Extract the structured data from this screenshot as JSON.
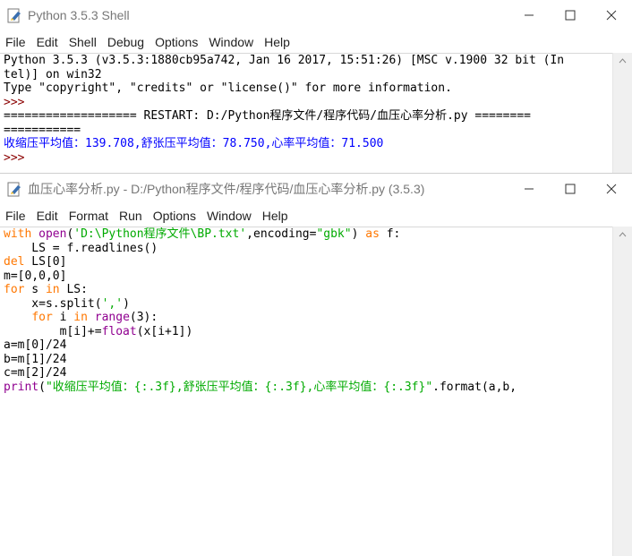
{
  "shell": {
    "title": "Python 3.5.3 Shell",
    "menu": [
      "File",
      "Edit",
      "Shell",
      "Debug",
      "Options",
      "Window",
      "Help"
    ],
    "lines": [
      "Python 3.5.3 (v3.5.3:1880cb95a742, Jan 16 2017, 15:51:26) [MSC v.1900 32 bit (In",
      "tel)] on win32",
      "Type \"copyright\", \"credits\" or \"license()\" for more information.",
      ">>>",
      "=================== RESTART: D:/Python程序文件/程序代码/血压心率分析.py ========",
      "===========",
      "收缩压平均值：139.708,舒张压平均值：78.750,心率平均值：71.500",
      ">>>"
    ]
  },
  "editor": {
    "title": "血压心率分析.py - D:/Python程序文件/程序代码/血压心率分析.py (3.5.3)",
    "menu": [
      "File",
      "Edit",
      "Format",
      "Run",
      "Options",
      "Window",
      "Help"
    ],
    "code": {
      "l1_kw": "with",
      "l1_b": "open",
      "l1_p1": "(",
      "l1_s1": "'D:\\Python程序文件\\BP.txt'",
      "l1_p2": ",encoding=",
      "l1_s2": "\"gbk\"",
      "l1_p3": ") ",
      "l1_kw2": "as",
      "l1_p4": " f:",
      "l2": "    LS = f.readlines()",
      "l3_kw": "del",
      "l3_p": " LS[0]",
      "l4": "m=[0,0,0]",
      "l5_kw": "for",
      "l5_p1": " s ",
      "l5_kw2": "in",
      "l5_p2": " LS:",
      "l6_p1": "    x=s.split(",
      "l6_s": "','",
      "l6_p2": ")",
      "l7_ind": "    ",
      "l7_kw": "for",
      "l7_p1": " i ",
      "l7_kw2": "in",
      "l7_sp": " ",
      "l7_b": "range",
      "l7_p2": "(3):",
      "l8_p1": "        m[i]+=",
      "l8_b": "float",
      "l8_p2": "(x[i+1])",
      "l9": "a=m[0]/24",
      "l10": "b=m[1]/24",
      "l11": "c=m[2]/24",
      "l12_b": "print",
      "l12_p1": "(",
      "l12_s": "\"收缩压平均值：{:.3f},舒张压平均值：{:.3f},心率平均值：{:.3f}\"",
      "l12_p2": ".format(a,b,"
    }
  }
}
